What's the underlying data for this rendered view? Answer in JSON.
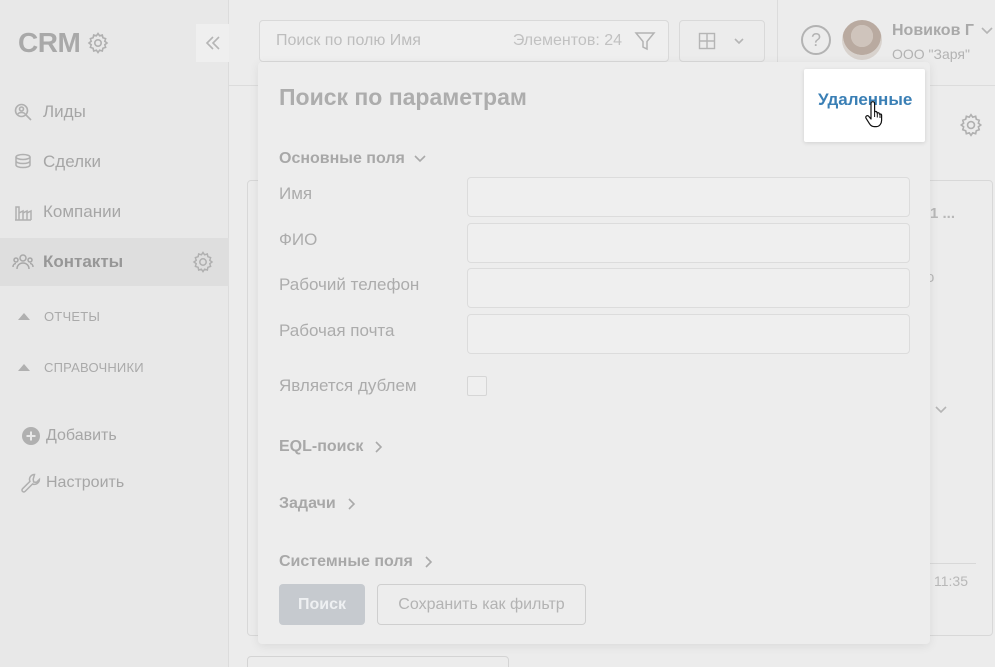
{
  "sidebar": {
    "logo": "CRM",
    "nav": [
      {
        "label": "Лиды",
        "icon": "leads-icon"
      },
      {
        "label": "Сделки",
        "icon": "deals-icon"
      },
      {
        "label": "Компании",
        "icon": "companies-icon"
      },
      {
        "label": "Контакты",
        "icon": "contacts-icon",
        "active": true
      }
    ],
    "sections": [
      {
        "label": "ОТЧЕТЫ"
      },
      {
        "label": "СПРАВОЧНИКИ"
      }
    ],
    "actions": [
      {
        "label": "Добавить",
        "icon": "plus-circle-icon"
      },
      {
        "label": "Настроить",
        "icon": "wrench-icon"
      }
    ]
  },
  "topbar": {
    "search_placeholder": "Поиск по полю Имя",
    "count_label": "Элементов: 24",
    "user_name": "Новиков Г",
    "user_org": "ООО \"Заря\""
  },
  "background": {
    "frag1": "1 ...",
    "frag2": "о",
    "time": "11:35"
  },
  "modal": {
    "title": "Поиск по параметрам",
    "groups": {
      "basic": "Основные поля",
      "eql": "EQL-поиск",
      "tasks": "Задачи",
      "system": "Системные поля"
    },
    "fields": [
      {
        "label": "Имя",
        "value": ""
      },
      {
        "label": "ФИО",
        "value": ""
      },
      {
        "label": "Рабочий телефон",
        "value": ""
      },
      {
        "label": "Рабочая почта",
        "value": ""
      }
    ],
    "checkbox_label": "Является дублем",
    "search_button": "Поиск",
    "save_filter_button": "Сохранить как фильтр"
  },
  "popup": {
    "deleted_link": "Удаленные"
  },
  "colors": {
    "link": "#3a7fb5",
    "primary_button": "#c6cacf"
  }
}
